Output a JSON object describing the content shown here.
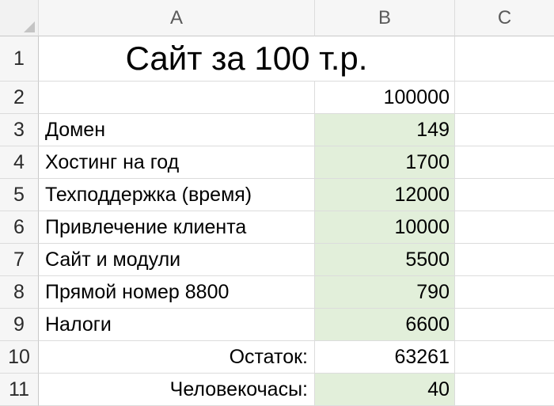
{
  "columns": [
    "A",
    "B",
    "C"
  ],
  "colors": {
    "green_fill": "#e2efda",
    "header_bg": "#f6f6f6",
    "grid": "#dcdcdc"
  },
  "rows": [
    {
      "num": "1",
      "a": "Сайт за 100 т.р.",
      "b": ""
    },
    {
      "num": "2",
      "a": "",
      "b": "100000"
    },
    {
      "num": "3",
      "a": "Домен",
      "b": "149"
    },
    {
      "num": "4",
      "a": "Хостинг на год",
      "b": "1700"
    },
    {
      "num": "5",
      "a": "Техподдержка (время)",
      "b": "12000"
    },
    {
      "num": "6",
      "a": "Привлечение клиента",
      "b": "10000"
    },
    {
      "num": "7",
      "a": "Сайт и модули",
      "b": "5500"
    },
    {
      "num": "8",
      "a": "Прямой номер 8800",
      "b": "790"
    },
    {
      "num": "9",
      "a": "Налоги",
      "b": "6600"
    },
    {
      "num": "10",
      "a": "Остаток:",
      "b": "63261"
    },
    {
      "num": "11",
      "a": "Человекочасы:",
      "b": "40"
    }
  ]
}
